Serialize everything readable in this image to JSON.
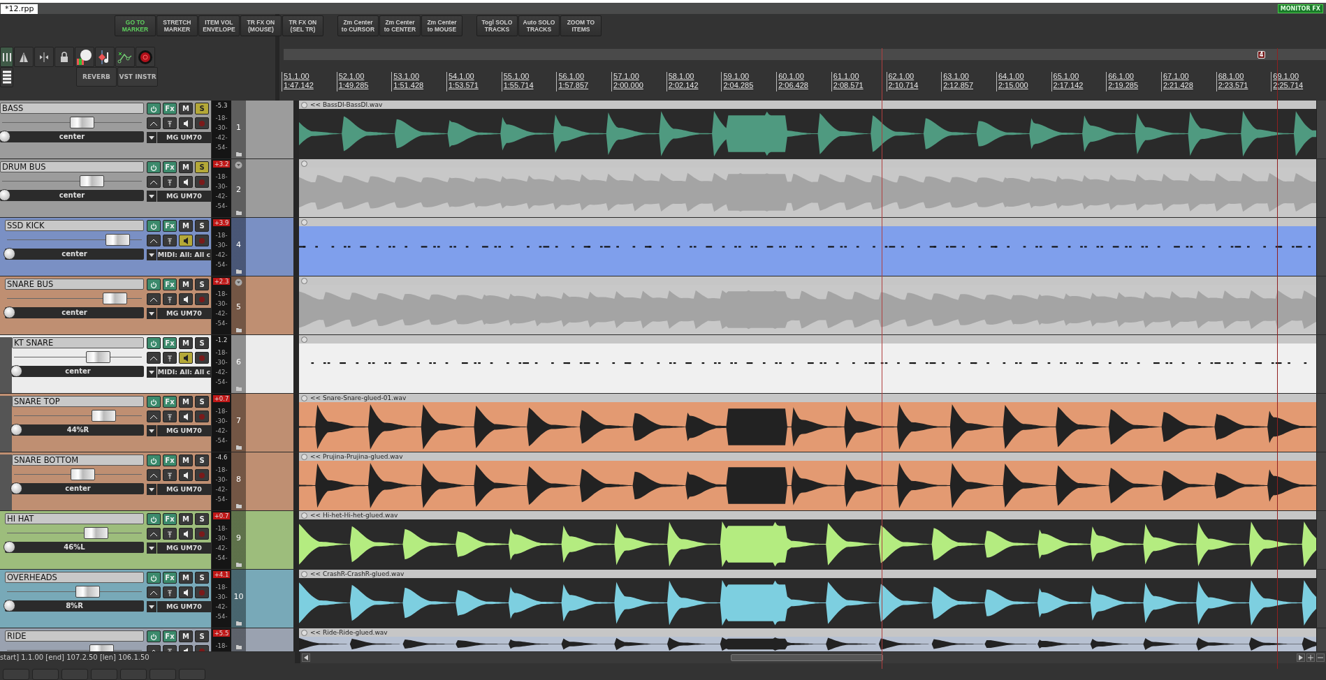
{
  "project_tab": {
    "title": "*12.rpp",
    "selected": true
  },
  "monitor_badge": "MONITOR FX",
  "icon_toolbar": [
    {
      "kind": "grid",
      "selected": true
    },
    {
      "kind": "ripple",
      "selected": false
    },
    {
      "kind": "split",
      "selected": false
    },
    {
      "kind": "lock",
      "selected": false
    },
    {
      "kind": "sws",
      "selected": false
    },
    {
      "kind": "note",
      "selected": false
    },
    {
      "kind": "envelope",
      "selected": false
    },
    {
      "kind": "record",
      "selected": false
    }
  ],
  "icon_toolbar_row2": {
    "piano": true,
    "buttons": [
      "REVERB",
      "VST INSTR"
    ]
  },
  "toolbar_groups": [
    [
      {
        "lines": [
          "GO TO",
          "MARKER"
        ],
        "active": true
      },
      {
        "lines": [
          "STRETCH",
          "MARKER"
        ],
        "active": false
      },
      {
        "lines": [
          "ITEM VOL",
          "ENVELOPE"
        ],
        "active": false
      },
      {
        "lines": [
          "TR FX ON",
          "(MOUSE)"
        ],
        "active": false
      },
      {
        "lines": [
          "TR FX ON",
          "(SEL TR)"
        ],
        "active": false
      }
    ],
    [
      {
        "lines": [
          "Zm Center",
          "to CURSOR"
        ],
        "active": false
      },
      {
        "lines": [
          "Zm Center",
          "to CENTER"
        ],
        "active": false
      },
      {
        "lines": [
          "Zm Center",
          "to MOUSE"
        ],
        "active": false
      }
    ],
    [
      {
        "lines": [
          "Togl SOLO",
          "TRACKS"
        ],
        "active": false
      },
      {
        "lines": [
          "Auto SOLO",
          "TRACKS"
        ],
        "active": false
      },
      {
        "lines": [
          "ZOOM TO",
          "ITEMS"
        ],
        "active": false
      }
    ]
  ],
  "ruler": {
    "marker": "4",
    "marks": [
      {
        "bar": "51.1.00",
        "time": "1:47.142"
      },
      {
        "bar": "52.1.00",
        "time": "1:49.285"
      },
      {
        "bar": "53.1.00",
        "time": "1:51.428"
      },
      {
        "bar": "54.1.00",
        "time": "1:53.571"
      },
      {
        "bar": "55.1.00",
        "time": "1:55.714"
      },
      {
        "bar": "56.1.00",
        "time": "1:57.857"
      },
      {
        "bar": "57.1.00",
        "time": "2:00.000"
      },
      {
        "bar": "58.1.00",
        "time": "2:02.142"
      },
      {
        "bar": "59.1.00",
        "time": "2:04.285"
      },
      {
        "bar": "60.1.00",
        "time": "2:06.428"
      },
      {
        "bar": "61.1.00",
        "time": "2:08.571"
      },
      {
        "bar": "62.1.00",
        "time": "2:10.714"
      },
      {
        "bar": "63.1.00",
        "time": "2:12.857"
      },
      {
        "bar": "64.1.00",
        "time": "2:15.000"
      },
      {
        "bar": "65.1.00",
        "time": "2:17.142"
      },
      {
        "bar": "66.1.00",
        "time": "2:19.285"
      },
      {
        "bar": "67.1.00",
        "time": "2:21.428"
      },
      {
        "bar": "68.1.00",
        "time": "2:23.571"
      },
      {
        "bar": "69.1.00",
        "time": "2:25.714"
      }
    ]
  },
  "tracks": [
    {
      "name": "BASS",
      "number": "1",
      "reading": "-5.3",
      "clip": false,
      "fader": {
        "level": 0.57
      },
      "pan": "center",
      "input": "MG UM70",
      "labels": [
        "Fx",
        "M",
        "S"
      ],
      "scale": [
        "-18-",
        "-30-",
        "-42-",
        "-54-"
      ],
      "solo": true,
      "monitor": false,
      "folder": false,
      "color": "#9c9c9c",
      "item": {
        "kind": "inverse",
        "label": "<< BassDI-BassDI.wav",
        "color": "#4f9a80"
      }
    },
    {
      "name": "DRUM BUS",
      "number": "2",
      "reading": "+3.2",
      "clip": true,
      "fader": {
        "level": 0.64
      },
      "pan": "center",
      "input": "MG UM70",
      "labels": [
        "Fx",
        "M",
        "S"
      ],
      "scale": [
        "-18-",
        "-30-",
        "-42-",
        "-54-"
      ],
      "solo": true,
      "monitor": false,
      "folder": true,
      "color": "#9c9c9c",
      "item": {
        "kind": "folder",
        "color": "#c8c8c8"
      },
      "children": [
        {
          "name": "SSD KICK",
          "number": "4",
          "reading": "+3.9",
          "clip": true,
          "fader": {
            "level": 0.82
          },
          "pan": "center",
          "input": "MIDI: All: All c",
          "labels": [
            "Fx",
            "M",
            "S"
          ],
          "scale": [
            "-18-",
            "-30-",
            "-42-",
            "-54-"
          ],
          "solo": false,
          "monitor": true,
          "folder": false,
          "color": "#7a90c4",
          "item": {
            "kind": "midi",
            "color": "#7f9fec"
          }
        },
        {
          "name": "SNARE BUS",
          "number": "5",
          "reading": "+2.3",
          "clip": true,
          "fader": {
            "level": 0.8
          },
          "pan": "center",
          "input": "MG UM70",
          "labels": [
            "Fx",
            "M",
            "S"
          ],
          "scale": [
            "-18-",
            "-30-",
            "-42-",
            "-54-"
          ],
          "solo": false,
          "monitor": false,
          "folder": true,
          "color": "#bf8f72",
          "item": {
            "kind": "folder",
            "color": "#c8c8c8"
          },
          "children": [
            {
              "name": "KT SNARE",
              "number": "6",
              "reading": "-1.2",
              "clip": false,
              "fader": {
                "level": 0.66
              },
              "pan": "center",
              "input": "MIDI: All: All c",
              "labels": [
                "Fx",
                "M",
                "S"
              ],
              "scale": [
                "-18-",
                "-30-",
                "-42-",
                "-54-"
              ],
              "solo": false,
              "monitor": true,
              "folder": false,
              "color": "#ececec",
              "item": {
                "kind": "midi",
                "color": "#f0f0f0"
              }
            },
            {
              "name": "SNARE TOP",
              "number": "7",
              "reading": "+0.7",
              "clip": true,
              "fader": {
                "level": 0.7
              },
              "pan": "44%R",
              "input": "MG UM70",
              "labels": [
                "Fx",
                "M",
                "S"
              ],
              "scale": [
                "-18-",
                "-30-",
                "-42-",
                "-54-"
              ],
              "solo": false,
              "monitor": false,
              "folder": false,
              "color": "#bf8f72",
              "item": {
                "kind": "wave",
                "label": "<< Snare-Snare-glued-01.wav",
                "color": "#e39a72"
              }
            },
            {
              "name": "SNARE BOTTOM",
              "number": "8",
              "reading": "-4.6",
              "clip": false,
              "fader": {
                "level": 0.54
              },
              "pan": "center",
              "input": "MG UM70",
              "labels": [
                "Fx",
                "M",
                "S"
              ],
              "scale": [
                "-18-",
                "-30-",
                "-42-",
                "-54-"
              ],
              "solo": false,
              "monitor": false,
              "folder": false,
              "color": "#bf8f72",
              "item": {
                "kind": "wave",
                "label": "<< Prujina-Prujina-glued.wav",
                "color": "#e39a72"
              }
            }
          ]
        },
        {
          "name": "HI HAT",
          "number": "9",
          "reading": "+0.7",
          "clip": true,
          "fader": {
            "level": 0.66
          },
          "pan": "46%L",
          "input": "MG UM70",
          "labels": [
            "Fx",
            "M",
            "S"
          ],
          "scale": [
            "-18-",
            "-30-",
            "-42-",
            "-54-"
          ],
          "solo": false,
          "monitor": false,
          "folder": false,
          "color": "#9dbd7c",
          "item": {
            "kind": "inverse",
            "label": "<< Hi-het-Hi-het-glued.wav",
            "color": "#b4ec80"
          }
        },
        {
          "name": "OVERHEADS",
          "number": "10",
          "reading": "+4.1",
          "clip": true,
          "fader": {
            "level": 0.6
          },
          "pan": "8%R",
          "input": "MG UM70",
          "labels": [
            "Fx",
            "M",
            "S"
          ],
          "scale": [
            "-18-",
            "-30-",
            "-42-",
            "-54-"
          ],
          "solo": false,
          "monitor": false,
          "folder": false,
          "color": "#78a9b8",
          "item": {
            "kind": "inverse",
            "label": "<< CrashR-CrashR-glued.wav",
            "color": "#7dcfe0"
          }
        },
        {
          "name": "RIDE",
          "reading": "+5.5",
          "clip": true,
          "fader": {
            "level": 0.7
          },
          "labels": [
            "Fx",
            "M",
            "S"
          ],
          "scale": [
            "-18-"
          ],
          "solo": false,
          "monitor": false,
          "folder": false,
          "color": "#9aa2b0",
          "item": {
            "kind": "wave",
            "label": "<< Ride-Ride-glued.wav",
            "color": "#b7c1d2"
          }
        }
      ]
    }
  ],
  "status": "start] 1.1.00 [end] 107.2.50 [len] 106.1.50"
}
